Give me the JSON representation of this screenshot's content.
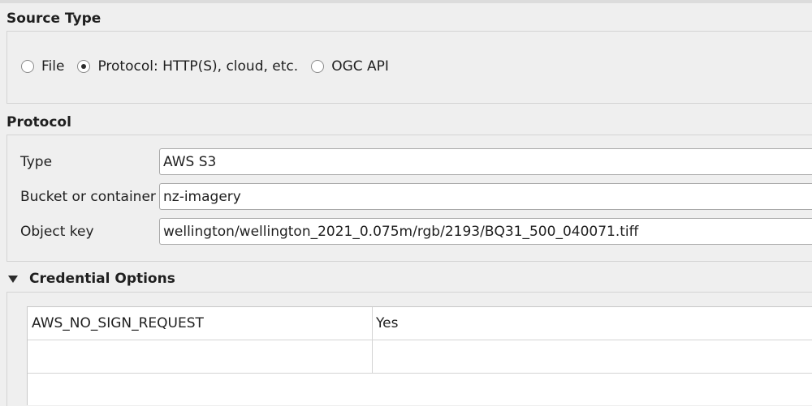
{
  "source_type": {
    "title": "Source Type",
    "options": [
      {
        "label": "File",
        "checked": false
      },
      {
        "label": "Protocol: HTTP(S), cloud, etc.",
        "checked": true
      },
      {
        "label": "OGC API",
        "checked": false
      }
    ]
  },
  "protocol": {
    "title": "Protocol",
    "type_label": "Type",
    "type_value": "AWS S3",
    "bucket_label": "Bucket or container",
    "bucket_value": "nz-imagery",
    "object_key_label": "Object key",
    "object_key_value": "wellington/wellington_2021_0.075m/rgb/2193/BQ31_500_040071.tiff"
  },
  "credential_options": {
    "title": "Credential Options",
    "expanded": true,
    "rows": [
      {
        "key": "AWS_NO_SIGN_REQUEST",
        "value": "Yes"
      },
      {
        "key": "",
        "value": ""
      }
    ]
  }
}
